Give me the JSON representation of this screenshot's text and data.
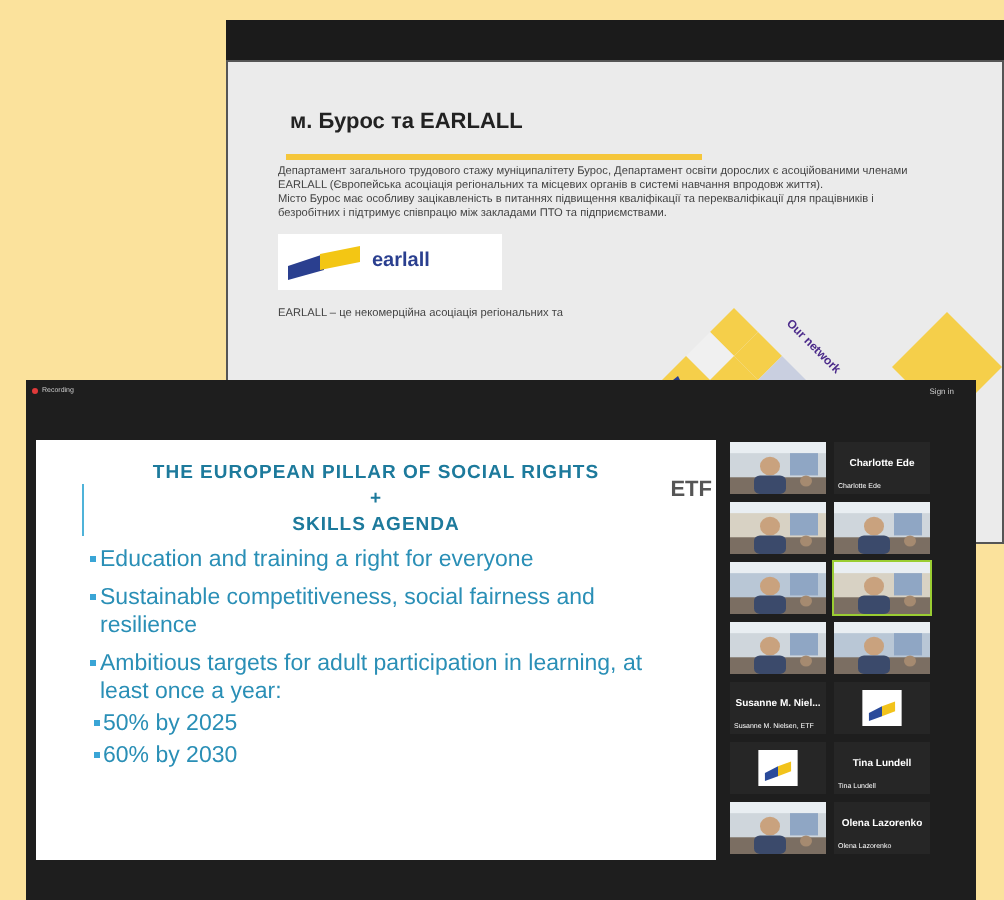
{
  "back_window": {
    "slide": {
      "title": "м. Бурос та EARLALL",
      "paragraphs": [
        "Департамент загального трудового стажу муніципалітету Бурос, Департамент освіти дорослих є асоційованими членами EARLALL (Європейська асоціація регіональних та місцевих органів в системі навчання впродовж життя).",
        "Місто Бурос має особливу зацікавленість в питаннях підвищення кваліфікації та перекваліфікації для працівників і безробітних і підтримує співпрацю між закладами ПТО та підприємствами."
      ],
      "logo_text": "earlall",
      "network_label": "Our network",
      "footer_text": "EARLALL – це некомерційна асоціація регіональних та"
    }
  },
  "front_window": {
    "recording": "Recording",
    "sign_in": "Sign in",
    "slide": {
      "title_lines": [
        "THE EUROPEAN PILLAR OF SOCIAL RIGHTS",
        "+",
        "SKILLS AGENDA"
      ],
      "logo": "ETF",
      "bullets": [
        {
          "text": "Education and training a right for everyone"
        },
        {
          "text": "Sustainable competitiveness, social fairness and resilience"
        },
        {
          "text": "Ambitious targets for adult participation in learning, at least once a year:",
          "children": [
            {
              "text": "50% by 2025"
            },
            {
              "text": "60% by 2030"
            }
          ]
        }
      ]
    },
    "gallery": [
      {
        "kind": "video",
        "active": false
      },
      {
        "kind": "name",
        "name": "Charlotte Ede",
        "label": "Charlotte Ede",
        "active": false
      },
      {
        "kind": "video",
        "active": false
      },
      {
        "kind": "video",
        "active": false
      },
      {
        "kind": "video",
        "active": false
      },
      {
        "kind": "video",
        "active": true
      },
      {
        "kind": "video",
        "active": false
      },
      {
        "kind": "video",
        "active": false
      },
      {
        "kind": "name",
        "name": "Susanne M. Niel...",
        "label": "Susanne M. Nielsen, ETF",
        "active": false
      },
      {
        "kind": "logo",
        "active": false
      },
      {
        "kind": "logo",
        "active": false
      },
      {
        "kind": "name",
        "name": "Tina Lundell",
        "label": "Tina Lundell",
        "active": false
      },
      {
        "kind": "video",
        "active": false
      },
      {
        "kind": "name",
        "name": "Olena Lazorenko",
        "label": "Olena Lazorenko",
        "active": false
      }
    ]
  }
}
